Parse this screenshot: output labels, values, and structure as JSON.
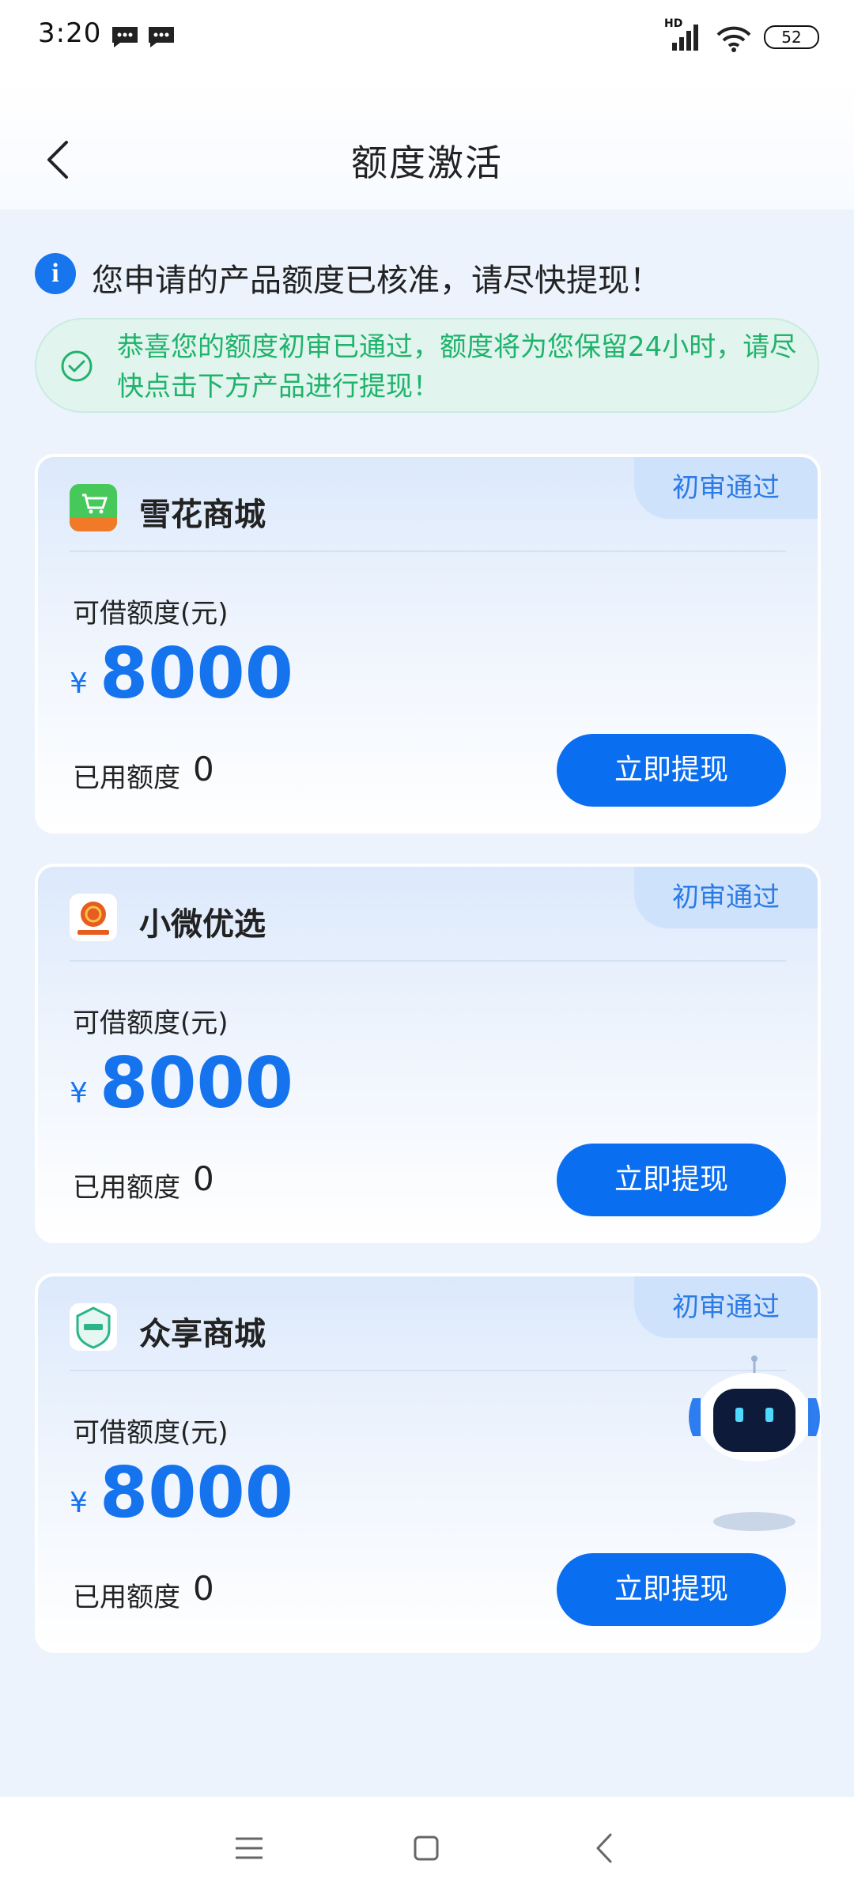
{
  "status_bar": {
    "time": "3:20",
    "network": "HD",
    "battery": "52"
  },
  "header": {
    "title": "额度激活"
  },
  "notice": {
    "text": "您申请的产品额度已核准，请尽快提现！"
  },
  "success_banner": {
    "text": "恭喜您的额度初审已通过，额度将为您保留24小时，请尽快点击下方产品进行提现！"
  },
  "cards": [
    {
      "name": "雪花商城",
      "badge": "初审通过",
      "limit_label": "可借额度(元)",
      "currency": "¥",
      "amount": "8000",
      "used_label": "已用额度",
      "used_value": "0",
      "button": "立即提现",
      "logo_text": "雪花商城"
    },
    {
      "name": "小微优选",
      "badge": "初审通过",
      "limit_label": "可借额度(元)",
      "currency": "¥",
      "amount": "8000",
      "used_label": "已用额度",
      "used_value": "0",
      "button": "立即提现",
      "logo_text": "小微优选"
    },
    {
      "name": "众享商城",
      "badge": "初审通过",
      "limit_label": "可借额度(元)",
      "currency": "¥",
      "amount": "8000",
      "used_label": "已用额度",
      "used_value": "0",
      "button": "立即提现",
      "logo_text": "众享商城"
    }
  ],
  "colors": {
    "accent": "#0a6ef0",
    "amount": "#1573ee",
    "success": "#1fb36b",
    "page_bg": "#ecf3fd"
  },
  "icons": {
    "back": "chevron-left-icon",
    "info": "info-icon",
    "success": "check-circle-icon",
    "nav_menu": "menu-icon",
    "nav_home": "square-icon",
    "nav_back": "chevron-left-icon"
  }
}
